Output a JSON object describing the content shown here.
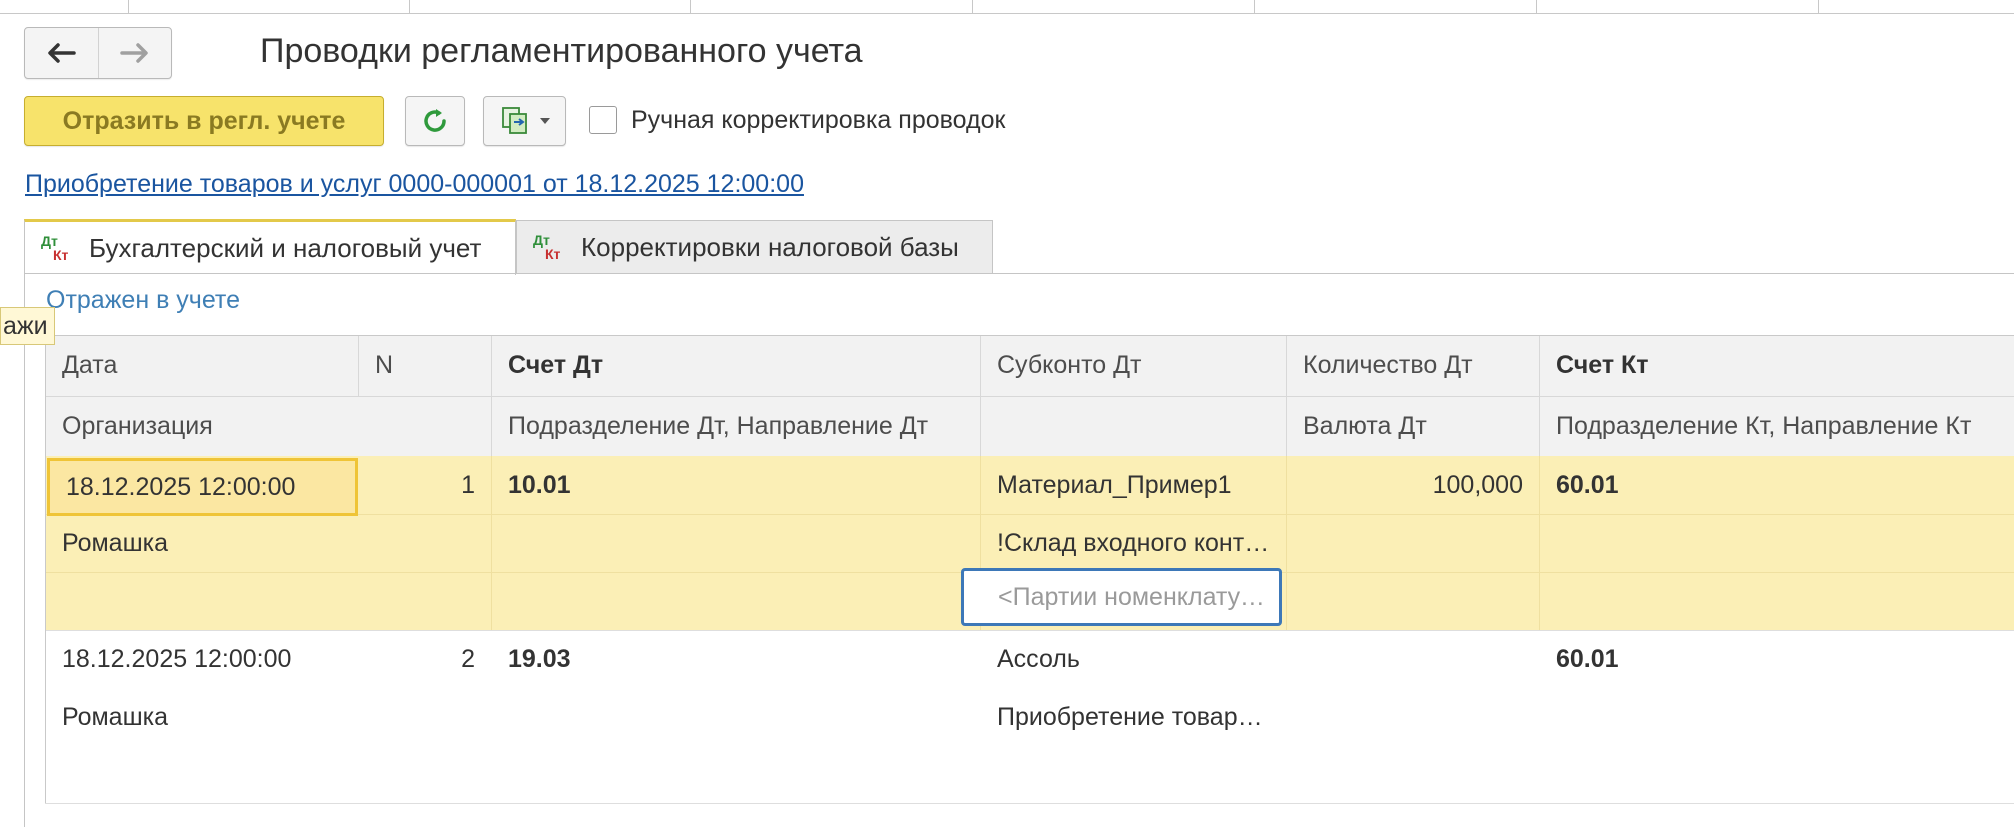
{
  "window": {
    "title": "Проводки регламентированного учета"
  },
  "toolbar": {
    "post_label": "Отразить в регл. учете",
    "manual_label": "Ручная корректировка проводок",
    "manual_checked": false
  },
  "document_link": "Приобретение товаров и услуг 0000-000001 от 18.12.2025 12:00:00",
  "tabs": [
    {
      "label": "Бухгалтерский и налоговый учет",
      "active": true,
      "icon": "dt-kt-icon"
    },
    {
      "label": "Корректировки налоговой базы",
      "active": false,
      "icon": "dt-kt-icon"
    }
  ],
  "status": "Отражен в учете",
  "tooltip_fragment": "ажи",
  "table": {
    "headers": {
      "date": "Дата",
      "n": "N",
      "account_dt": "Счет Дт",
      "subconto_dt": "Субконто Дт",
      "quantity_dt": "Количество Дт",
      "account_kt": "Счет Кт",
      "organization": "Организация",
      "division_dt": "Подразделение Дт, Направление Дт",
      "currency_dt": "Валюта Дт",
      "division_kt": "Подразделение Кт, Направление Кт"
    },
    "rows": [
      {
        "date": "18.12.2025 12:00:00",
        "n": "1",
        "account_dt": "10.01",
        "subconto_dt_1": "Материал_Пример1",
        "quantity_dt": "100,000",
        "account_kt": "60.01",
        "organization": "Ромашка",
        "subconto_dt_2": "!Склад входного контроля",
        "subconto_dt_3": "<Партии номенклатуры>"
      },
      {
        "date": "18.12.2025 12:00:00",
        "n": "2",
        "account_dt": "19.03",
        "subconto_dt_1": "Ассоль",
        "account_kt": "60.01",
        "organization": "Ромашка",
        "subconto_dt_2": "Приобретение товаров и услуг"
      }
    ]
  },
  "colors": {
    "accent_yellow": "#f7e36b",
    "selected_row": "#fbefb6",
    "link_blue": "#1a55a0",
    "status_blue": "#3f7fb5",
    "focus_blue": "#3d78b8"
  }
}
